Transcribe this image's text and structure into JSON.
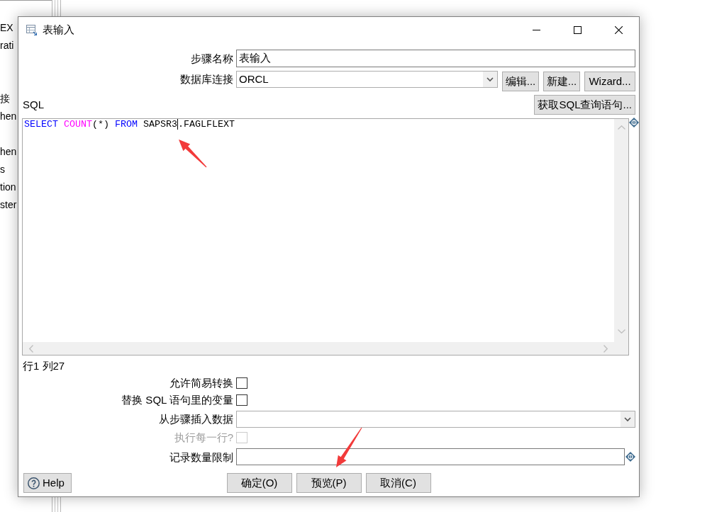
{
  "background_window": {
    "label_groups": [
      [
        "EX",
        "rati"
      ],
      [
        "接",
        "hen"
      ],
      [
        "hen",
        "s",
        "tion",
        "ster"
      ]
    ]
  },
  "dialog": {
    "title": "表输入",
    "fields": [
      {
        "kind": "text",
        "label": "步骤名称",
        "value": "表输入"
      },
      {
        "kind": "select",
        "label": "数据库连接",
        "value": "ORCL",
        "buttons": [
          {
            "label": "编辑..."
          },
          {
            "label": "新建..."
          },
          {
            "label": "Wizard..."
          }
        ]
      }
    ],
    "sql_label": "SQL",
    "get_sql_button": {
      "label": "获取SQL查询语句..."
    },
    "sql_editor": {
      "variable": true,
      "tokens": [
        {
          "text": "SELECT ",
          "kind": "keyword",
          "caret_after": false
        },
        {
          "text": "COUNT",
          "kind": "function",
          "caret_after": false
        },
        {
          "text": "(*) ",
          "kind": "plain",
          "caret_after": false
        },
        {
          "text": "FROM ",
          "kind": "keyword",
          "caret_after": false
        },
        {
          "text": "SAPSR3",
          "kind": "plain",
          "caret_after": true
        },
        {
          "text": ".FAGLFLEXT",
          "kind": "plain",
          "caret_after": false
        }
      ]
    },
    "cursor_position": "行1 列27",
    "options": [
      {
        "kind": "checkbox",
        "label": "允许简易转换",
        "checked": false,
        "disabled": false
      },
      {
        "kind": "checkbox",
        "label": "替换 SQL 语句里的变量",
        "checked": false,
        "disabled": false
      },
      {
        "kind": "select",
        "label": "从步骤插入数据"
      },
      {
        "kind": "checkbox",
        "label": "执行每一行?",
        "checked": false,
        "disabled": true
      },
      {
        "kind": "text",
        "label": "记录数量限制",
        "variable": true
      }
    ],
    "help_button": {
      "label": "Help"
    },
    "buttons": [
      {
        "label": "确定(O)"
      },
      {
        "label": "预览(P)"
      },
      {
        "label": "取消(C)"
      }
    ]
  }
}
